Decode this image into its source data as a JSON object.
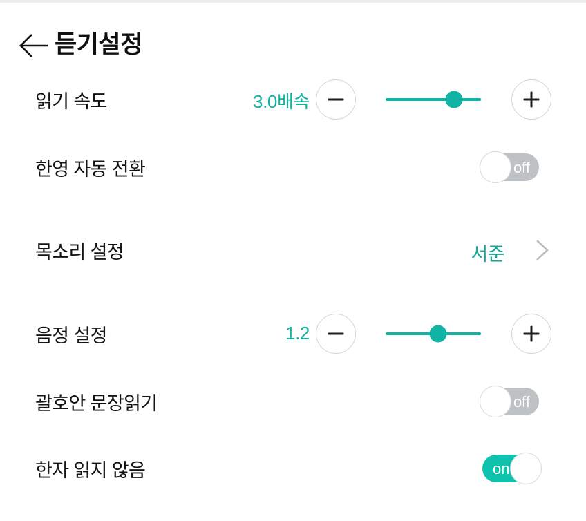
{
  "header": {
    "title": "듣기설정",
    "back_icon": "arrow-left-icon"
  },
  "rows": {
    "reading_speed": {
      "label": "읽기 속도",
      "value": "3.0배속",
      "decrease_label": "−",
      "increase_label": "+",
      "slider_percent": 72
    },
    "auto_switch": {
      "label": "한영 자동 전환",
      "state": "off",
      "state_label": "off"
    },
    "voice_setting": {
      "label": "목소리 설정",
      "value": "서준",
      "chevron_icon": "chevron-right-icon"
    },
    "pitch_setting": {
      "label": "음정 설정",
      "value": "1.2",
      "decrease_label": "−",
      "increase_label": "+",
      "slider_percent": 55
    },
    "parenthesis_reading": {
      "label": "괄호안 문장읽기",
      "state": "off",
      "state_label": "off"
    },
    "skip_hanja": {
      "label": "한자 읽지 않음",
      "state": "on",
      "state_label": "on"
    }
  },
  "colors": {
    "accent": "#11b3a4",
    "toggle_on": "#0ec2ae",
    "toggle_off": "#bfc2c4",
    "text": "#141414"
  }
}
